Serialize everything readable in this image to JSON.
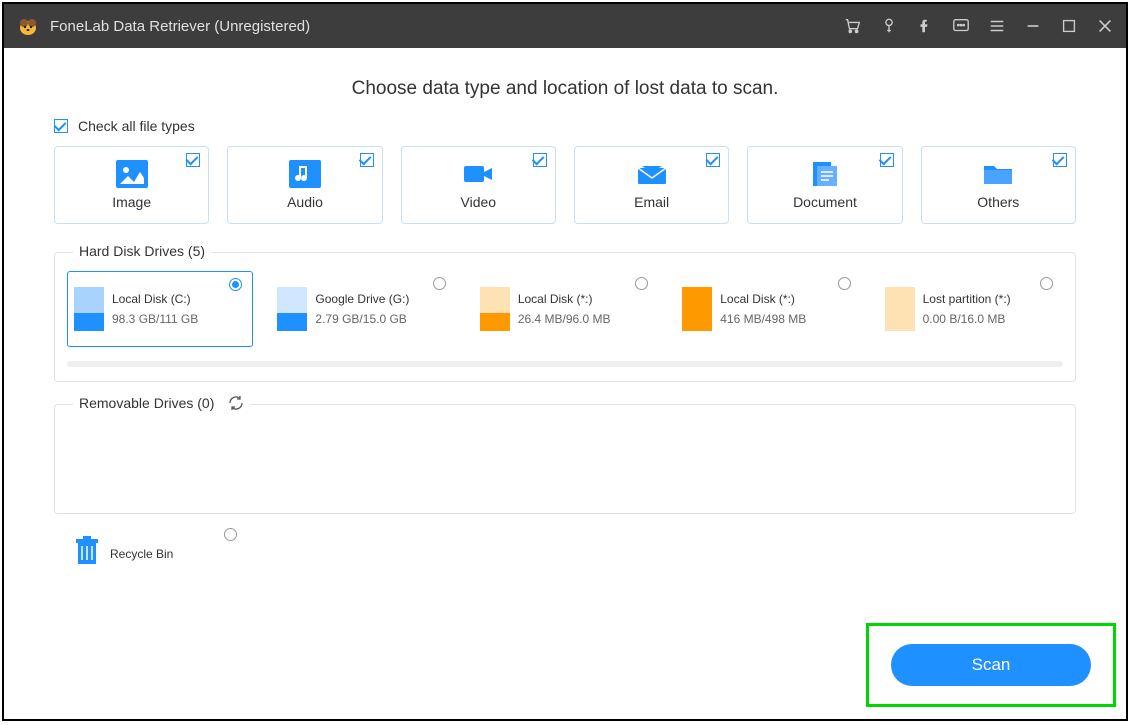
{
  "titlebar": {
    "title": "FoneLab Data Retriever (Unregistered)"
  },
  "heading": "Choose data type and location of lost data to scan.",
  "checkAllLabel": "Check all file types",
  "fileTypes": [
    {
      "label": "Image"
    },
    {
      "label": "Audio"
    },
    {
      "label": "Video"
    },
    {
      "label": "Email"
    },
    {
      "label": "Document"
    },
    {
      "label": "Others"
    }
  ],
  "hardDisk": {
    "legend": "Hard Disk Drives (5)",
    "drives": [
      {
        "name": "Local Disk (C:)",
        "size": "98.3 GB/111 GB",
        "topColor": "#a9d3ff",
        "botColor": "#1e90ff",
        "selected": true
      },
      {
        "name": "Google Drive (G:)",
        "size": "2.79 GB/15.0 GB",
        "topColor": "#cfe7ff",
        "botColor": "#1e90ff",
        "selected": false
      },
      {
        "name": "Local Disk (*:)",
        "size": "26.4 MB/96.0 MB",
        "topColor": "#ffe2b3",
        "botColor": "#ff9900",
        "selected": false
      },
      {
        "name": "Local Disk (*:)",
        "size": "416 MB/498 MB",
        "topColor": "#ff9900",
        "botColor": "#ff9900",
        "selected": false
      },
      {
        "name": "Lost partition (*:)",
        "size": "0.00  B/16.0 MB",
        "topColor": "#ffe2b3",
        "botColor": "#ffe2b3",
        "selected": false
      }
    ]
  },
  "removable": {
    "legend": "Removable Drives (0)"
  },
  "recycle": {
    "label": "Recycle Bin"
  },
  "scanLabel": "Scan"
}
